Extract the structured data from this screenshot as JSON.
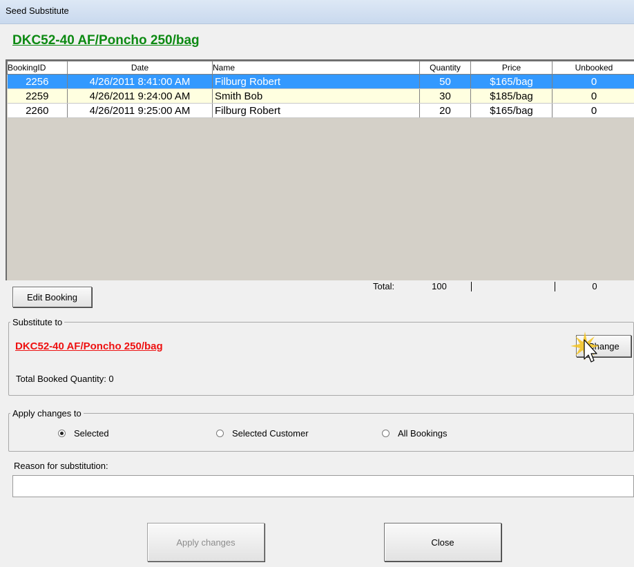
{
  "window": {
    "title": "Seed Substitute"
  },
  "product": {
    "name": "DKC52-40 AF/Poncho 250/bag"
  },
  "bookings": {
    "columns": [
      "BookingID",
      "Date",
      "Name",
      "Quantity",
      "Price",
      "Unbooked"
    ],
    "rows": [
      {
        "id": "2256",
        "date": "4/26/2011 8:41:00 AM",
        "name": "Filburg Robert",
        "quantity": "50",
        "price": "$165/bag",
        "unbooked": "0"
      },
      {
        "id": "2259",
        "date": "4/26/2011 9:24:00 AM",
        "name": "Smith Bob",
        "quantity": "30",
        "price": "$185/bag",
        "unbooked": "0"
      },
      {
        "id": "2260",
        "date": "4/26/2011 9:25:00 AM",
        "name": "Filburg Robert",
        "quantity": "20",
        "price": "$165/bag",
        "unbooked": "0"
      }
    ],
    "total_label": "Total:",
    "total_quantity": "100",
    "total_unbooked": "0"
  },
  "edit_button": "Edit Booking",
  "substitute": {
    "legend": "Substitute to",
    "product": "DKC52-40 AF/Poncho 250/bag",
    "change_button": "Change",
    "total_booked": "Total Booked Quantity: 0"
  },
  "apply_to": {
    "legend": "Apply changes to",
    "options": [
      {
        "label": "Selected",
        "checked": true
      },
      {
        "label": "Selected Customer",
        "checked": false
      },
      {
        "label": "All Bookings",
        "checked": false
      }
    ]
  },
  "reason": {
    "label": "Reason for substitution:",
    "value": ""
  },
  "buttons": {
    "apply": "Apply changes",
    "close": "Close"
  },
  "colors": {
    "heading": "#0d8a13",
    "substitute_product": "#ee1111",
    "selected_row": "#3399ff",
    "alt_row": "#ffffe0"
  }
}
